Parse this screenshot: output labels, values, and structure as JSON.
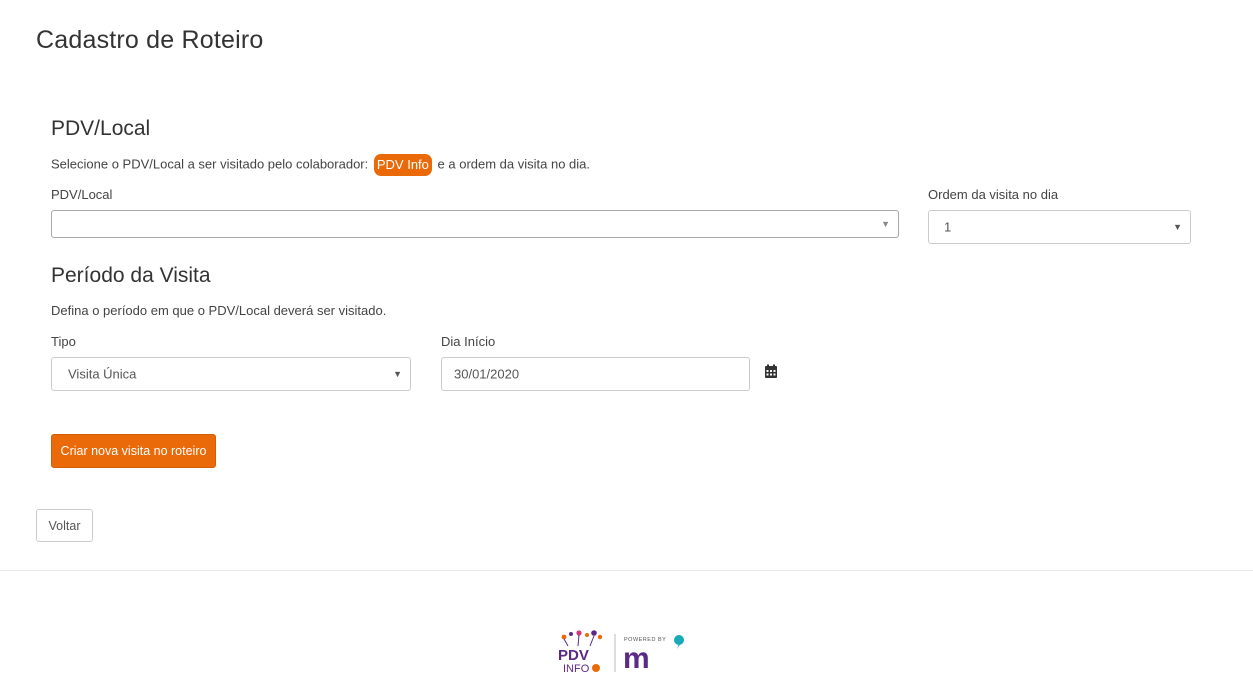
{
  "page": {
    "title": "Cadastro de Roteiro"
  },
  "pdv_section": {
    "title": "PDV/Local",
    "desc_before": "Selecione o PDV/Local a ser visitado pelo colaborador:",
    "chip": "PDV Info",
    "desc_after": "e a ordem da visita no dia.",
    "pdv_label": "PDV/Local",
    "pdv_value": "",
    "order_label": "Ordem da visita no dia",
    "order_value": "1"
  },
  "period_section": {
    "title": "Período da Visita",
    "desc": "Defina o período em que o PDV/Local deverá ser visitado.",
    "type_label": "Tipo",
    "type_value": "Visita Única",
    "start_label": "Dia Início",
    "start_value": "30/01/2020"
  },
  "actions": {
    "create_label": "Criar nova visita no roteiro",
    "back_label": "Voltar"
  },
  "footer": {
    "logo_pdv_top": "PDV",
    "logo_pdv_bottom": "INFO",
    "powered_by": "POWERED BY",
    "brand_mark": "m"
  },
  "colors": {
    "accent": "#ea6a0a",
    "logo_purple": "#5b2a86",
    "logo_teal": "#1aa9b8"
  },
  "icons": {
    "calendar": "calendar-icon",
    "caret": "caret-down-icon"
  }
}
